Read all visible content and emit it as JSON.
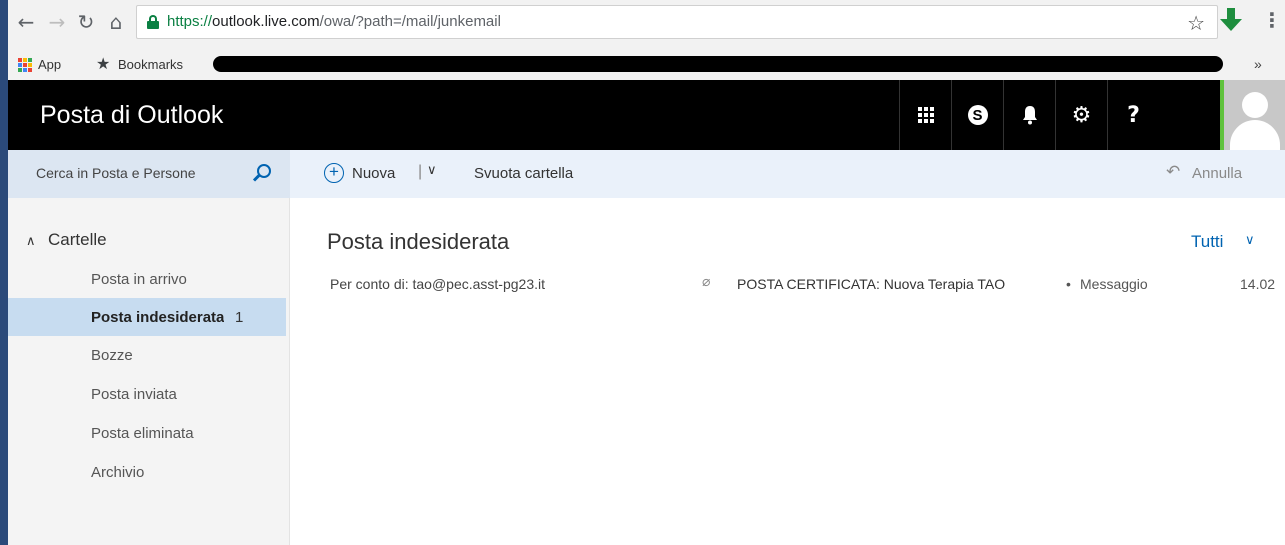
{
  "browser": {
    "url_scheme": "https://",
    "url_host": "outlook.live.com",
    "url_path": "/owa/?path=/mail/junkemail",
    "bookmarks": [
      {
        "label": "App",
        "icon": "apps-grid-icon"
      },
      {
        "label": "Bookmarks",
        "icon": "star-icon"
      }
    ],
    "more_label": "»"
  },
  "header": {
    "title": "Posta di Outlook",
    "buttons": [
      {
        "icon": "app-launcher-icon"
      },
      {
        "icon": "skype-icon"
      },
      {
        "icon": "bell-icon"
      },
      {
        "icon": "gear-icon"
      },
      {
        "icon": "help-icon",
        "glyph": "?"
      }
    ],
    "accent_color": "#5fc23c"
  },
  "search": {
    "placeholder": "Cerca in Posta e Persone"
  },
  "toolbar": {
    "new_label": "Nuova",
    "new_separator": "|",
    "empty_label": "Svuota cartella",
    "undo_label": "Annulla"
  },
  "folders": {
    "header": "Cartelle",
    "items": [
      {
        "label": "Posta in arrivo",
        "count": "",
        "active": false
      },
      {
        "label": "Posta indesiderata",
        "count": "1",
        "active": true
      },
      {
        "label": "Bozze",
        "count": "",
        "active": false
      },
      {
        "label": "Posta inviata",
        "count": "",
        "active": false
      },
      {
        "label": "Posta eliminata",
        "count": "",
        "active": false
      },
      {
        "label": "Archivio",
        "count": "",
        "active": false
      }
    ]
  },
  "main": {
    "title": "Posta indesiderata",
    "filter_label": "Tutti",
    "messages": [
      {
        "sender": "Per conto di: tao@pec.asst-pg23.it",
        "has_attachment": true,
        "subject": "POSTA CERTIFICATA: Nuova Terapia TAO",
        "separator": "•",
        "preview": "Messaggio",
        "date": "14.02"
      }
    ]
  },
  "colors": {
    "brand_blue": "#0063b1",
    "header_bg": "#000000",
    "selected_folder": "#c7dcf0",
    "secure_green": "#0b8043"
  }
}
